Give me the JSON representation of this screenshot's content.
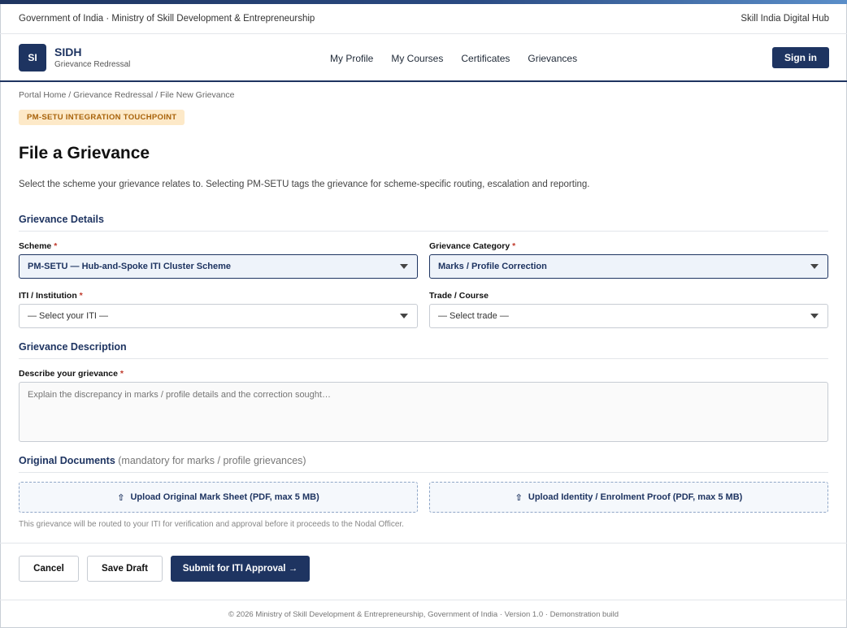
{
  "gov_bar": {
    "left": "Government of India · Ministry of Skill Development & Entrepreneurship",
    "right": "Skill India Digital Hub"
  },
  "header": {
    "logo_text": "SI",
    "brand_name": "SIDH",
    "brand_sub": "Grievance Redressal",
    "nav": [
      "My Profile",
      "My Courses",
      "Certificates",
      "Grievances"
    ],
    "signin_label": "Sign in"
  },
  "breadcrumb": "Portal Home / Grievance Redressal / File New Grievance",
  "badge": "PM-SETU INTEGRATION TOUCHPOINT",
  "page_title": "File a Grievance",
  "intro": "Select the scheme your grievance relates to. Selecting PM-SETU tags the grievance for scheme-specific routing, escalation and reporting.",
  "details": {
    "title": "Grievance Details",
    "scheme_label": "Scheme",
    "scheme_value": "PM-SETU — Hub-and-Spoke ITI Cluster Scheme",
    "category_label": "Grievance Category",
    "category_value": "Marks / Profile Correction",
    "iti_label": "ITI / Institution",
    "iti_value": "— Select your ITI —",
    "trade_label": "Trade / Course",
    "trade_value": "— Select trade —"
  },
  "description": {
    "title": "Grievance Description",
    "label": "Describe your grievance",
    "placeholder": "Explain the discrepancy in marks / profile details and the correction sought…"
  },
  "documents": {
    "title": "Original Documents",
    "note": "(mandatory for marks / profile grievances)",
    "upload_1": "Upload Original Mark Sheet (PDF, max 5 MB)",
    "upload_2": "Upload Identity / Enrolment Proof (PDF, max 5 MB)",
    "icon_glyph": "⇧",
    "hint": "This grievance will be routed to your ITI for verification and approval before it proceeds to the Nodal Officer."
  },
  "actions": {
    "cancel": "Cancel",
    "save_draft": "Save Draft",
    "submit": "Submit for ITI Approval →"
  },
  "footer": "© 2026 Ministry of Skill Development & Entrepreneurship, Government of India · Version 1.0 · Demonstration build",
  "required_mark": "*",
  "colors": {
    "brand": "#1e3461",
    "badge_bg": "#fde9c8",
    "badge_text": "#a8620a",
    "required": "#c0392b"
  }
}
